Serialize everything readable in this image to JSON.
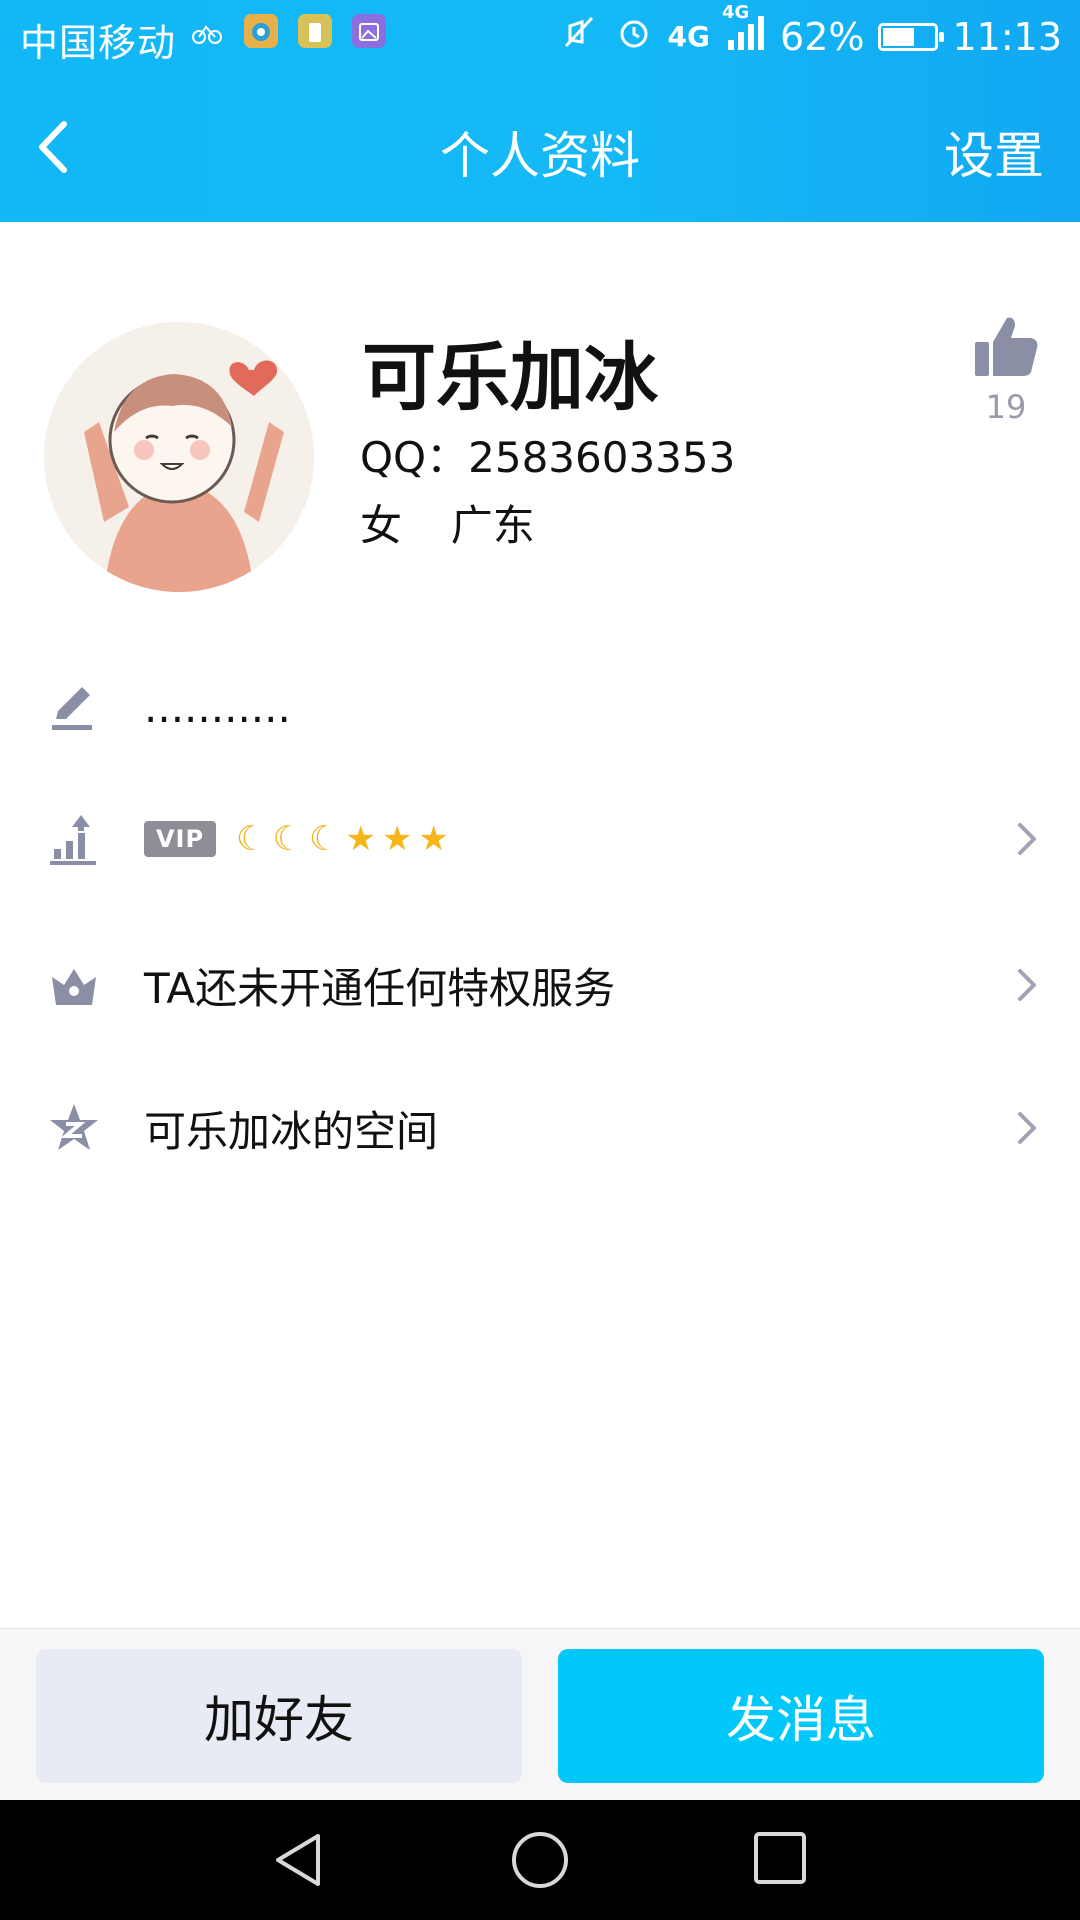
{
  "status_bar": {
    "carrier": "中国移动",
    "network": "4G",
    "network2": "4G",
    "battery_percent": "62%",
    "battery_level": 0.62,
    "time": "11:13"
  },
  "navbar": {
    "back_icon": "chevron-left-icon",
    "title": "个人资料",
    "settings_label": "设置"
  },
  "profile": {
    "nickname": "可乐加冰",
    "qq_label": "QQ：",
    "qq_number": "2583603353",
    "gender": "女",
    "location": "广东",
    "like_icon": "thumbs-up-icon",
    "like_count": "19"
  },
  "rows": {
    "signature": {
      "icon": "pencil-icon",
      "text": "..........."
    },
    "level": {
      "icon": "level-chart-icon",
      "badge": "VIP",
      "moons": 3,
      "stars": 3
    },
    "privilege": {
      "icon": "crown-icon",
      "text": "TA还未开通任何特权服务"
    },
    "qzone": {
      "icon": "qzone-star-icon",
      "text": "可乐加冰的空间"
    }
  },
  "actions": {
    "add_friend": "加好友",
    "send_message": "发消息"
  },
  "colors": {
    "header": "#12b7f5",
    "primary_button": "#00c8fa",
    "secondary_button": "#e8ebf3",
    "icon_gray": "#8b8fa6"
  }
}
